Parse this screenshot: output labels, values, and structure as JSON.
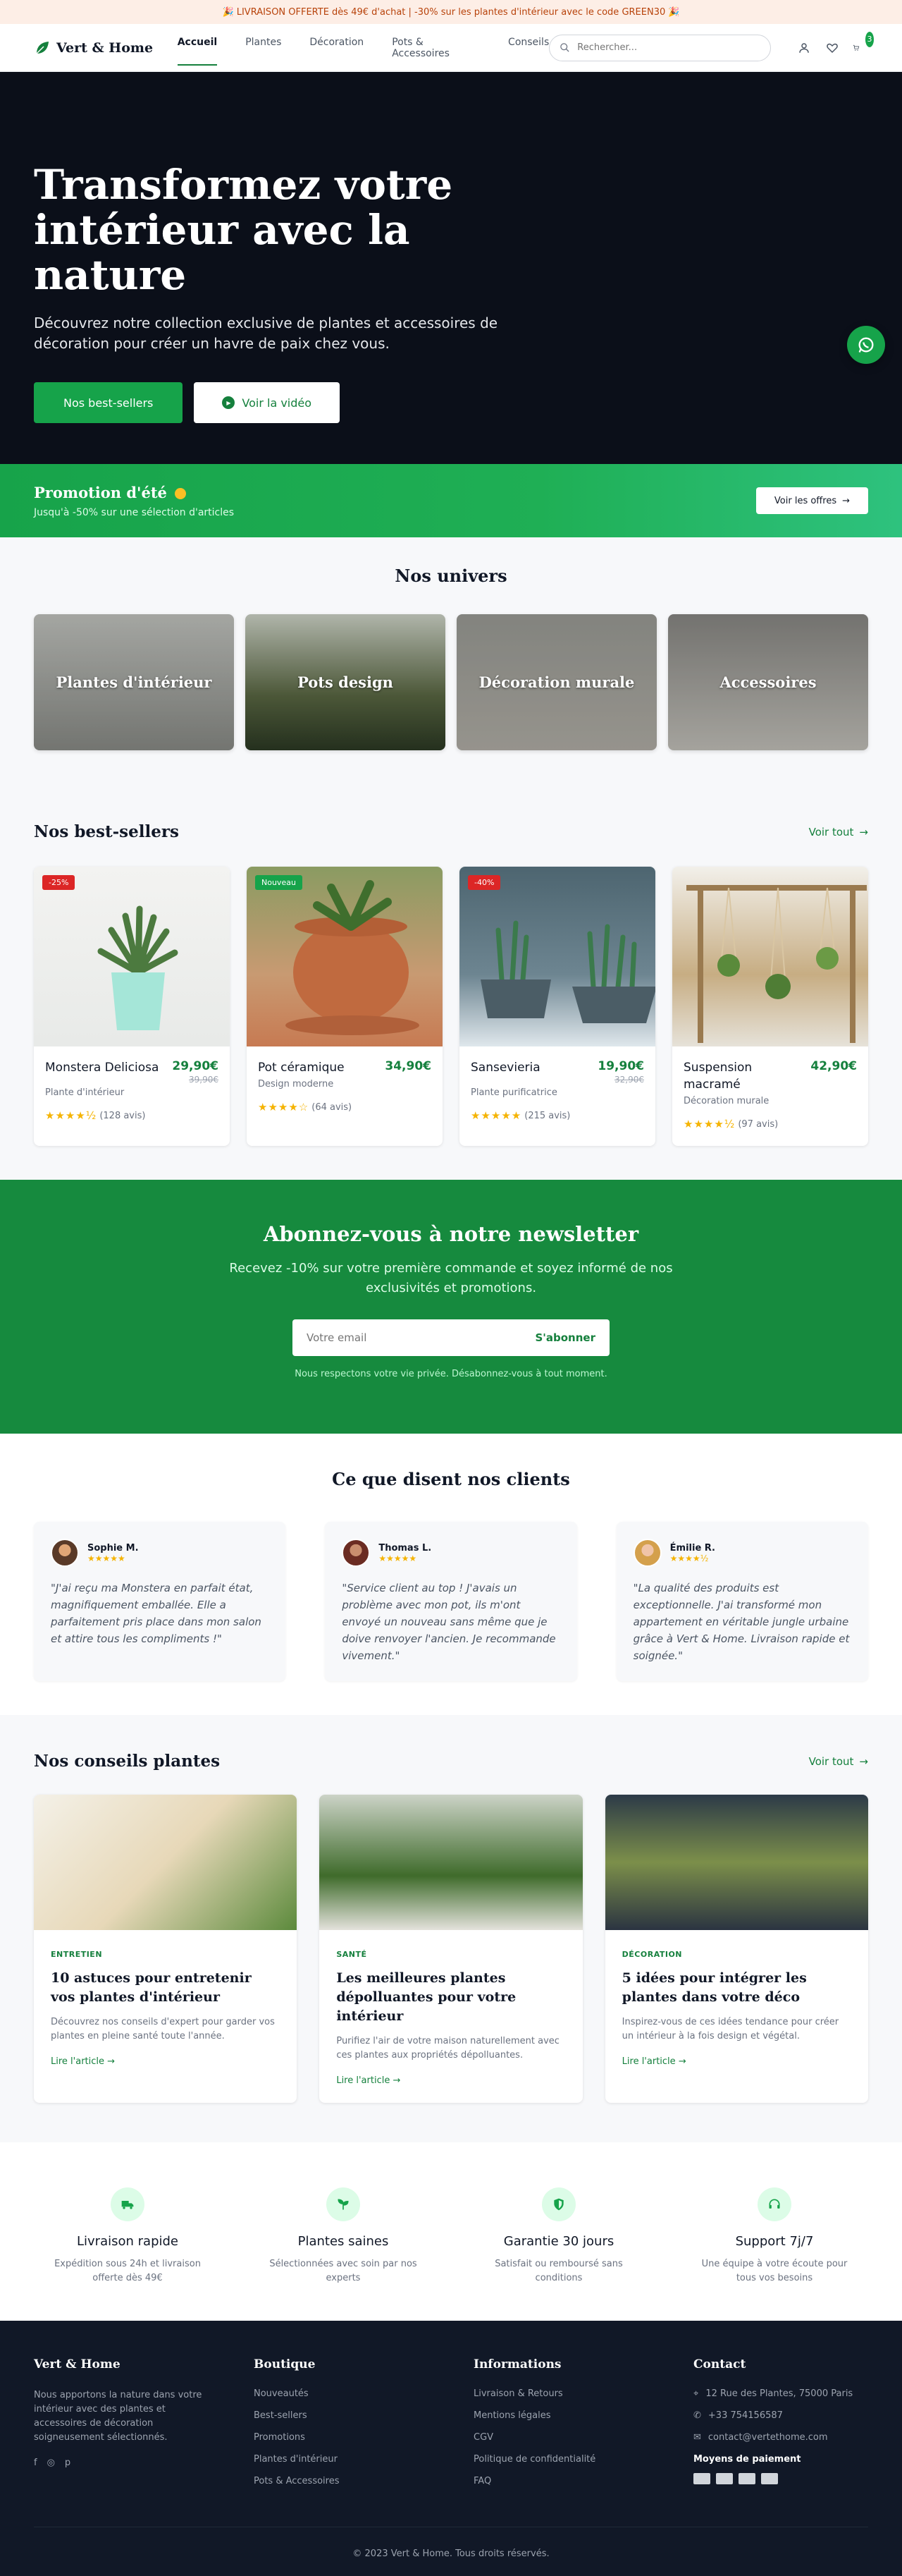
{
  "promo": {
    "text": "LIVRAISON OFFERTE dès 49€ d'achat | -30% sur les plantes d'intérieur avec le code GREEN30"
  },
  "header": {
    "logo": "Vert & Home",
    "nav": [
      {
        "label": "Accueil",
        "active": true
      },
      {
        "label": "Plantes"
      },
      {
        "label": "Décoration"
      },
      {
        "label": "Pots & Accessoires"
      },
      {
        "label": "Conseils"
      }
    ],
    "search_placeholder": "Rechercher...",
    "cart_count": "3"
  },
  "hero": {
    "title": "Transformez votre intérieur avec la nature",
    "subtitle": "Découvrez notre collection exclusive de plantes et accessoires de décoration pour créer un havre de paix chez vous.",
    "btn_primary": "Nos best-sellers",
    "btn_secondary": "Voir la vidéo"
  },
  "summer": {
    "title": "Promotion d'été",
    "subtitle": "Jusqu'à -50% sur une sélection d'articles",
    "button": "Voir les offres"
  },
  "univers": {
    "title": "Nos univers",
    "items": [
      {
        "label": "Plantes d'intérieur"
      },
      {
        "label": "Pots design"
      },
      {
        "label": "Décoration murale"
      },
      {
        "label": "Accessoires"
      }
    ]
  },
  "best": {
    "title": "Nos best-sellers",
    "see_all": "Voir tout",
    "products": [
      {
        "badge": "-25%",
        "name": "Monstera Deliciosa",
        "category": "Plante d'intérieur",
        "price": "29,90€",
        "old_price": "39,90€",
        "stars": "★★★★½",
        "reviews": "(128 avis)"
      },
      {
        "badge": "Nouveau",
        "name": "Pot céramique",
        "category": "Design moderne",
        "price": "34,90€",
        "old_price": "",
        "stars": "★★★★☆",
        "reviews": "(64 avis)"
      },
      {
        "badge": "-40%",
        "name": "Sansevieria",
        "category": "Plante purificatrice",
        "price": "19,90€",
        "old_price": "32,90€",
        "stars": "★★★★★",
        "reviews": "(215 avis)"
      },
      {
        "badge": "",
        "name": "Suspension macramé",
        "category": "Décoration murale",
        "price": "42,90€",
        "old_price": "",
        "stars": "★★★★½",
        "reviews": "(97 avis)"
      }
    ]
  },
  "newsletter": {
    "title": "Abonnez-vous à notre newsletter",
    "lead": "Recevez -10% sur votre première commande et soyez informé de nos exclusivités et promotions.",
    "placeholder": "Votre email",
    "button": "S'abonner",
    "privacy": "Nous respectons votre vie privée. Désabonnez-vous à tout moment."
  },
  "testimonials": {
    "title": "Ce que disent nos clients",
    "items": [
      {
        "name": "Sophie M.",
        "stars": "★★★★★",
        "text": "\"J'ai reçu ma Monstera en parfait état, magnifiquement emballée. Elle a parfaitement pris place dans mon salon et attire tous les compliments !\""
      },
      {
        "name": "Thomas L.",
        "stars": "★★★★★",
        "text": "\"Service client au top ! J'avais un problème avec mon pot, ils m'ont envoyé un nouveau sans même que je doive renvoyer l'ancien. Je recommande vivement.\""
      },
      {
        "name": "Émilie R.",
        "stars": "★★★★½",
        "text": "\"La qualité des produits est exceptionnelle. J'ai transformé mon appartement en véritable jungle urbaine grâce à Vert & Home. Livraison rapide et soignée.\""
      }
    ]
  },
  "conseils": {
    "title": "Nos conseils plantes",
    "see_all": "Voir tout",
    "items": [
      {
        "tag": "ENTRETIEN",
        "title": "10 astuces pour entretenir vos plantes d'intérieur",
        "text": "Découvrez nos conseils d'expert pour garder vos plantes en pleine santé toute l'année.",
        "link": "Lire l'article"
      },
      {
        "tag": "SANTÉ",
        "title": "Les meilleures plantes dépolluantes pour votre intérieur",
        "text": "Purifiez l'air de votre maison naturellement avec ces plantes aux propriétés dépolluantes.",
        "link": "Lire l'article"
      },
      {
        "tag": "DÉCORATION",
        "title": "5 idées pour intégrer les plantes dans votre déco",
        "text": "Inspirez-vous de ces idées tendance pour créer un intérieur à la fois design et végétal.",
        "link": "Lire l'article"
      }
    ]
  },
  "features": [
    {
      "title": "Livraison rapide",
      "text": "Expédition sous 24h et livraison offerte dès 49€"
    },
    {
      "title": "Plantes saines",
      "text": "Sélectionnées avec soin par nos experts"
    },
    {
      "title": "Garantie 30 jours",
      "text": "Satisfait ou remboursé sans conditions"
    },
    {
      "title": "Support 7j/7",
      "text": "Une équipe à votre écoute pour tous vos besoins"
    }
  ],
  "footer": {
    "brand": "Vert & Home",
    "desc": "Nous apportons la nature dans votre intérieur avec des plantes et accessoires de décoration soigneusement sélectionnés.",
    "boutique_title": "Boutique",
    "boutique": [
      "Nouveautés",
      "Best-sellers",
      "Promotions",
      "Plantes d'intérieur",
      "Pots & Accessoires"
    ],
    "info_title": "Informations",
    "info": [
      "Livraison & Retours",
      "Mentions légales",
      "CGV",
      "Politique de confidentialité",
      "FAQ"
    ],
    "contact_title": "Contact",
    "address": "12 Rue des Plantes, 75000 Paris",
    "phone": "+33 754156587",
    "email": "contact@vertethome.com",
    "payment_title": "Moyens de paiement",
    "copyright": "© 2023 Vert & Home. Tous droits réservés."
  },
  "colors": {
    "accent": "#16a34a",
    "dark": "#0b0f19",
    "footer": "#111827",
    "promo_bg": "#fdeee6"
  }
}
